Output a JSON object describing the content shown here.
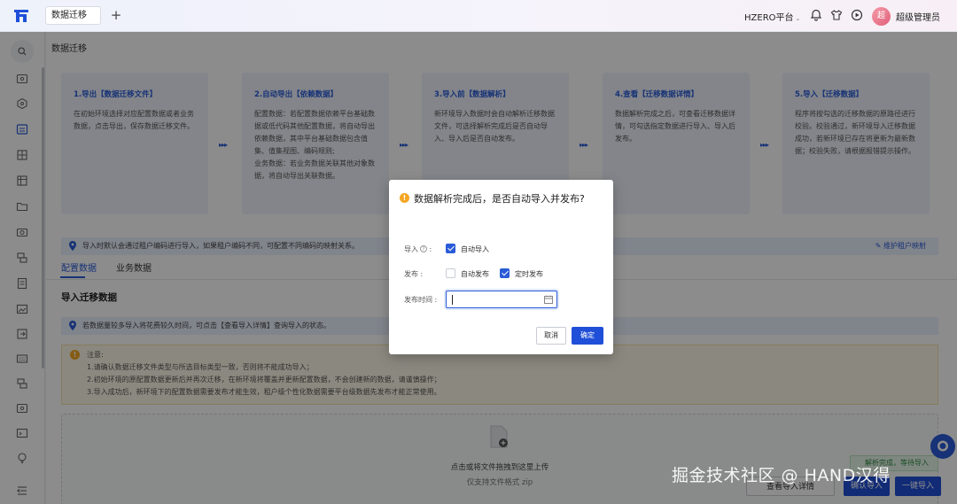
{
  "topbar": {
    "tab_label": "数据迁移",
    "add_tab": "+",
    "platform": "HZERO平台",
    "avatar_char": "超",
    "username": "超级管理员"
  },
  "page": {
    "title": "数据迁移",
    "steps": [
      {
        "title": "1.导出【数据迁移文件】",
        "body": "在初始环境选择对应配置数据或者业务数据，点击导出，保存数据迁移文件。"
      },
      {
        "title": "2.自动导出【依赖数据】",
        "body": "配置数据：若配置数据依赖平台基础数据或低代码其他配置数据，将自动导出依赖数据，其中平台基础数据包含值集、值集视图、编码规则;\n业务数据：若业务数据关联其他对象数据，将自动导出关联数据。"
      },
      {
        "title": "3.导入前【数据解析】",
        "body": "新环境导入数据时会自动解析迁移数据文件，可选择解析完成后是否自动导入、导入后是否自动发布。"
      },
      {
        "title": "4.查看【迁移数据详情】",
        "body": "数据解析完成之后，可查看迁移数据详情，可勾选指定数据进行导入、导入后发布。"
      },
      {
        "title": "5.导入【迁移数据】",
        "body": "程序将按勾选的迁移数据的原路径进行校验。校验通过，新环境导入迁移数据成功，若新环境已存在将更新为最新数据；校验失败，请根据报错提示操作。"
      }
    ],
    "info_text": "导入时默认会通过租户编码进行导入，如果租户编码不同，可配置不同编码的映射关系。",
    "maintain_link": "维护租户映射",
    "subtabs": [
      "配置数据",
      "业务数据"
    ],
    "section_title": "导入迁移数据",
    "tip_text": "若数据量较多导入将花费较久时间，可点击【查看导入详情】查询导入的状态。",
    "warn_title": "注意:",
    "warn_lines": [
      "1.请确认数据迁移文件类型与所选目标类型一致，否则将不能成功导入；",
      "2.初始环境的原配置数据更新后并再次迁移，在新环境将覆盖并更新配置数据，不会创建新的数据，请谨慎操作；",
      "3.导入成功后，新环境下的配置数据需要发布才能生效，租户级个性化数据需要平台级数据先发布才能正常使用。"
    ],
    "upload_text": "点击或将文件拖拽到这里上传",
    "upload_hint": "仅支持文件格式 zip",
    "success_tag": "解析完成，等待导入",
    "bottom_buttons": [
      "查看导入详情",
      "确认导入",
      "一键导入"
    ]
  },
  "dialog": {
    "title": "数据解析完成后，是否自动导入并发布?",
    "import_label": "导入",
    "import_option": "自动导入",
    "publish_label": "发布",
    "publish_options": [
      "自动发布",
      "定时发布"
    ],
    "publish_time_label": "发布时间",
    "cancel": "取消",
    "ok": "确定"
  },
  "watermark": "掘金技术社区 @ HAND汉得",
  "colors": {
    "accent": "#2a5bd7",
    "warning": "#f5a623"
  }
}
